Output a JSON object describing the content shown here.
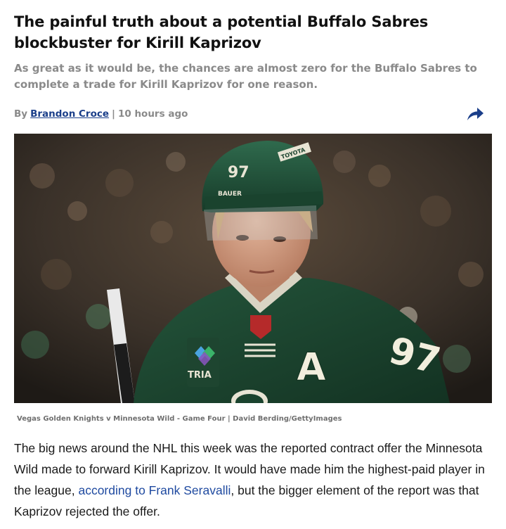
{
  "article": {
    "headline": "The painful truth about a potential Buffalo Sabres blockbuster for Kirill Kaprizov",
    "subheadline": "As great as it would be, the chances are almost zero for the Buffalo Sabres to complete a trade for Kirill Kaprizov for one reason.",
    "byline": {
      "prefix": "By",
      "author": "Brandon Croce",
      "separator": "|",
      "time": "10 hours ago"
    },
    "share_icon": "share-arrow-icon",
    "image": {
      "jersey_number": "97",
      "captain_letter": "A",
      "helmet_brand": "BAUER",
      "helmet_sponsor": "TOYOTA",
      "patch_text": "TRIA"
    },
    "caption": "Vegas Golden Knights v Minnesota Wild - Game Four | David Berding/GettyImages",
    "body": {
      "text_before": "The big news around the NHL this week was the reported contract offer the Minnesota Wild made to forward Kirill Kaprizov. It would have made him the highest-paid player in the league, ",
      "link_text": "according to Frank Seravalli",
      "text_after": ", but the bigger element of the report was that Kaprizov rejected the offer."
    }
  },
  "colors": {
    "author_link": "#1b3f8a",
    "body_link": "#1f4aa0",
    "subhead": "#8a8a8a",
    "jersey_green": "#1f4a33"
  }
}
